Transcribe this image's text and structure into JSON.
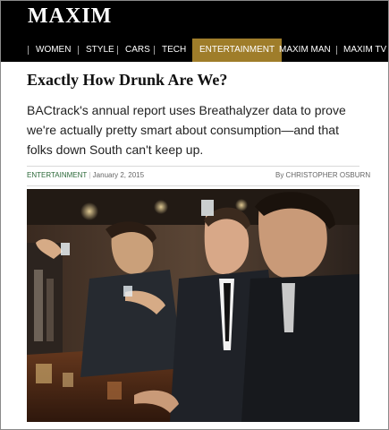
{
  "site": {
    "logo": "MAXIM"
  },
  "nav": {
    "items": [
      {
        "label": "WOMEN",
        "active": false
      },
      {
        "label": "STYLE",
        "active": false
      },
      {
        "label": "CARS",
        "active": false
      },
      {
        "label": "TECH",
        "active": false
      },
      {
        "label": "ENTERTAINMENT",
        "active": true
      },
      {
        "label": "MAXIM MAN",
        "active": false
      },
      {
        "label": "MAXIM TV",
        "active": false
      }
    ],
    "active_color": "#9f7d2a"
  },
  "article": {
    "headline": "Exactly How Drunk Are We?",
    "dek": "BACtrack's annual report uses Breathalyzer data to prove we're actually pretty smart about consumption—and that folks down South can't keep up.",
    "category": "ENTERTAINMENT",
    "separator": "|",
    "date": "January 2, 2015",
    "byline": "By CHRISTOPHER OSBURN"
  },
  "photo": {
    "subject": "men-taking-shots-at-bar"
  }
}
